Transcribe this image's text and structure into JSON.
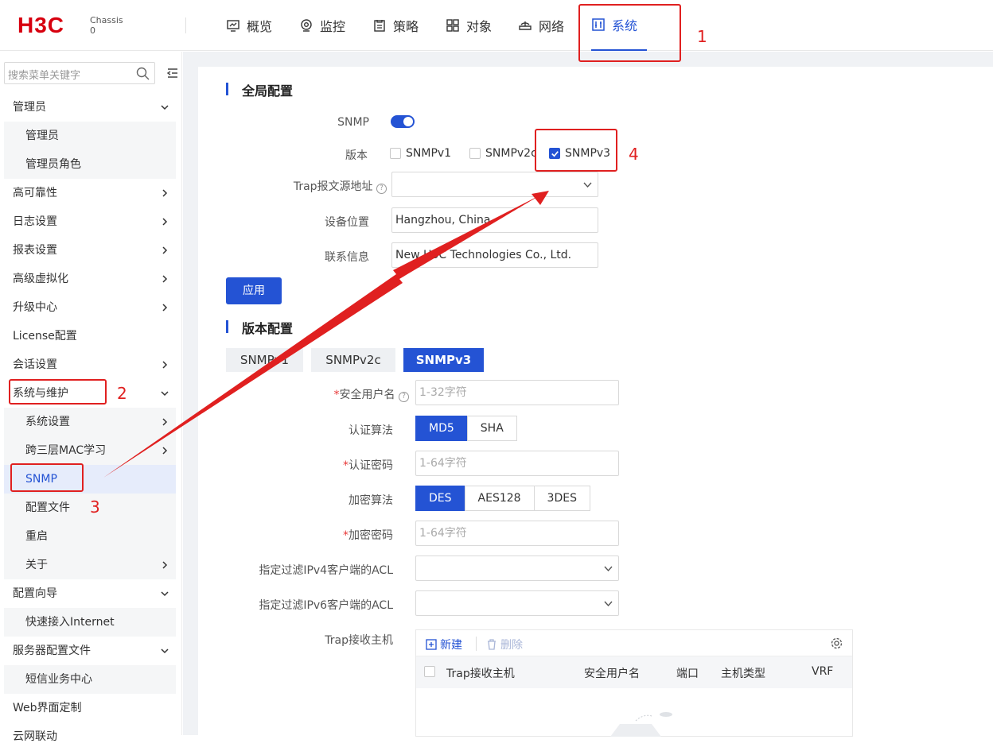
{
  "brand": {
    "logo": "H3C",
    "chassis": "Chassis",
    "chassis_num": "0"
  },
  "nav": [
    {
      "label": "概览",
      "icon": "overview-icon"
    },
    {
      "label": "监控",
      "icon": "monitor-icon"
    },
    {
      "label": "策略",
      "icon": "policy-icon"
    },
    {
      "label": "对象",
      "icon": "object-icon"
    },
    {
      "label": "网络",
      "icon": "network-icon"
    },
    {
      "label": "系统",
      "icon": "system-icon",
      "active": true
    }
  ],
  "sidebar": {
    "search_placeholder": "搜索菜单关键字",
    "items": [
      {
        "label": "管理员",
        "level": 1,
        "chevron": "down"
      },
      {
        "label": "管理员",
        "level": 2
      },
      {
        "label": "管理员角色",
        "level": 2
      },
      {
        "label": "高可靠性",
        "level": 1,
        "chevron": "right"
      },
      {
        "label": "日志设置",
        "level": 1,
        "chevron": "right"
      },
      {
        "label": "报表设置",
        "level": 1,
        "chevron": "right"
      },
      {
        "label": "高级虚拟化",
        "level": 1,
        "chevron": "right"
      },
      {
        "label": "升级中心",
        "level": 1,
        "chevron": "right"
      },
      {
        "label": "License配置",
        "level": 1
      },
      {
        "label": "会话设置",
        "level": 1,
        "chevron": "right"
      },
      {
        "label": "系统与维护",
        "level": 1,
        "chevron": "down"
      },
      {
        "label": "系统设置",
        "level": 2,
        "chevron": "right"
      },
      {
        "label": "跨三层MAC学习",
        "level": 2,
        "chevron": "right"
      },
      {
        "label": "SNMP",
        "level": 2,
        "selected": true
      },
      {
        "label": "配置文件",
        "level": 2
      },
      {
        "label": "重启",
        "level": 2
      },
      {
        "label": "关于",
        "level": 2,
        "chevron": "right"
      },
      {
        "label": "配置向导",
        "level": 1,
        "chevron": "down"
      },
      {
        "label": "快速接入Internet",
        "level": 2
      },
      {
        "label": "服务器配置文件",
        "level": 1,
        "chevron": "down"
      },
      {
        "label": "短信业务中心",
        "level": 2
      },
      {
        "label": "Web界面定制",
        "level": 1
      },
      {
        "label": "云网联动",
        "level": 1
      }
    ]
  },
  "global": {
    "title": "全局配置",
    "snmp_label": "SNMP",
    "snmp_enabled": true,
    "version_label": "版本",
    "versions": [
      {
        "label": "SNMPv1",
        "checked": false
      },
      {
        "label": "SNMPv2c",
        "checked": false
      },
      {
        "label": "SNMPv3",
        "checked": true
      }
    ],
    "trap_src_label": "Trap报文源地址",
    "trap_src_value": "",
    "location_label": "设备位置",
    "location_value": "Hangzhou, China",
    "contact_label": "联系信息",
    "contact_value": "New H3C Technologies Co., Ltd.",
    "apply": "应用"
  },
  "version": {
    "title": "版本配置",
    "tabs": [
      {
        "label": "SNMPv1"
      },
      {
        "label": "SNMPv2c"
      },
      {
        "label": "SNMPv3",
        "active": true
      }
    ],
    "user_label": "安全用户名",
    "user_placeholder": "1-32字符",
    "auth_alg_label": "认证算法",
    "auth_opts": [
      {
        "label": "MD5",
        "on": true
      },
      {
        "label": "SHA",
        "on": false
      }
    ],
    "auth_pwd_label": "认证密码",
    "auth_pwd_placeholder": "1-64字符",
    "enc_alg_label": "加密算法",
    "enc_opts": [
      {
        "label": "DES",
        "on": true
      },
      {
        "label": "AES128",
        "on": false
      },
      {
        "label": "3DES",
        "on": false
      }
    ],
    "enc_pwd_label": "加密密码",
    "enc_pwd_placeholder": "1-64字符",
    "acl4_label": "指定过滤IPv4客户端的ACL",
    "acl6_label": "指定过滤IPv6客户端的ACL",
    "trap_host_label": "Trap接收主机",
    "new_btn": "新建",
    "del_btn": "删除",
    "columns": [
      "Trap接收主机",
      "安全用户名",
      "端口",
      "主机类型",
      "VRF"
    ]
  },
  "annotations": [
    "1",
    "2",
    "3",
    "4"
  ],
  "colors": {
    "accent": "#2453d4",
    "annotation": "#e02020",
    "brand": "#d7000f"
  }
}
